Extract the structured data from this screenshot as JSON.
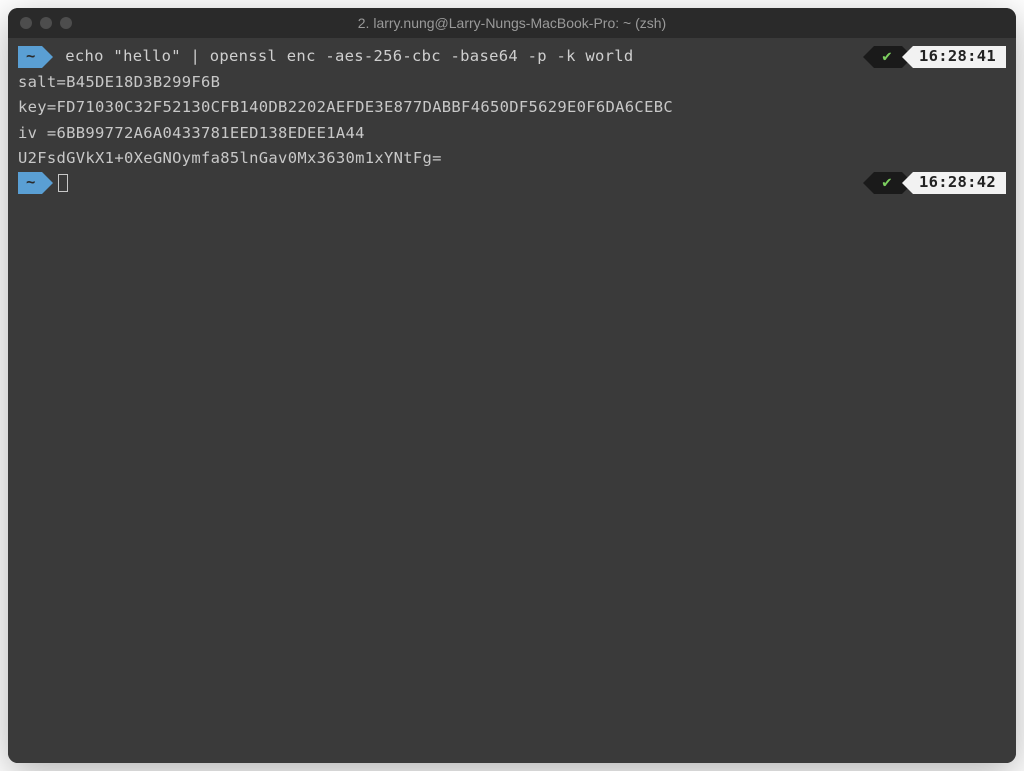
{
  "window": {
    "title": "2. larry.nung@Larry-Nungs-MacBook-Pro: ~ (zsh)"
  },
  "lines": [
    {
      "prompt": "~",
      "command": " echo \"hello\" | openssl enc -aes-256-cbc -base64 -p -k world",
      "status_icon": "✔",
      "time": "16:28:41"
    }
  ],
  "output": [
    "salt=B45DE18D3B299F6B",
    "key=FD71030C32F52130CFB140DB2202AEFDE3E877DABBF4650DF5629E0F6DA6CEBC",
    "iv =6BB99772A6A0433781EED138EDEE1A44",
    "U2FsdGVkX1+0XeGNOymfa85lnGav0Mx3630m1xYNtFg="
  ],
  "prompt2": {
    "prompt": "~",
    "status_icon": "✔",
    "time": "16:28:42"
  }
}
